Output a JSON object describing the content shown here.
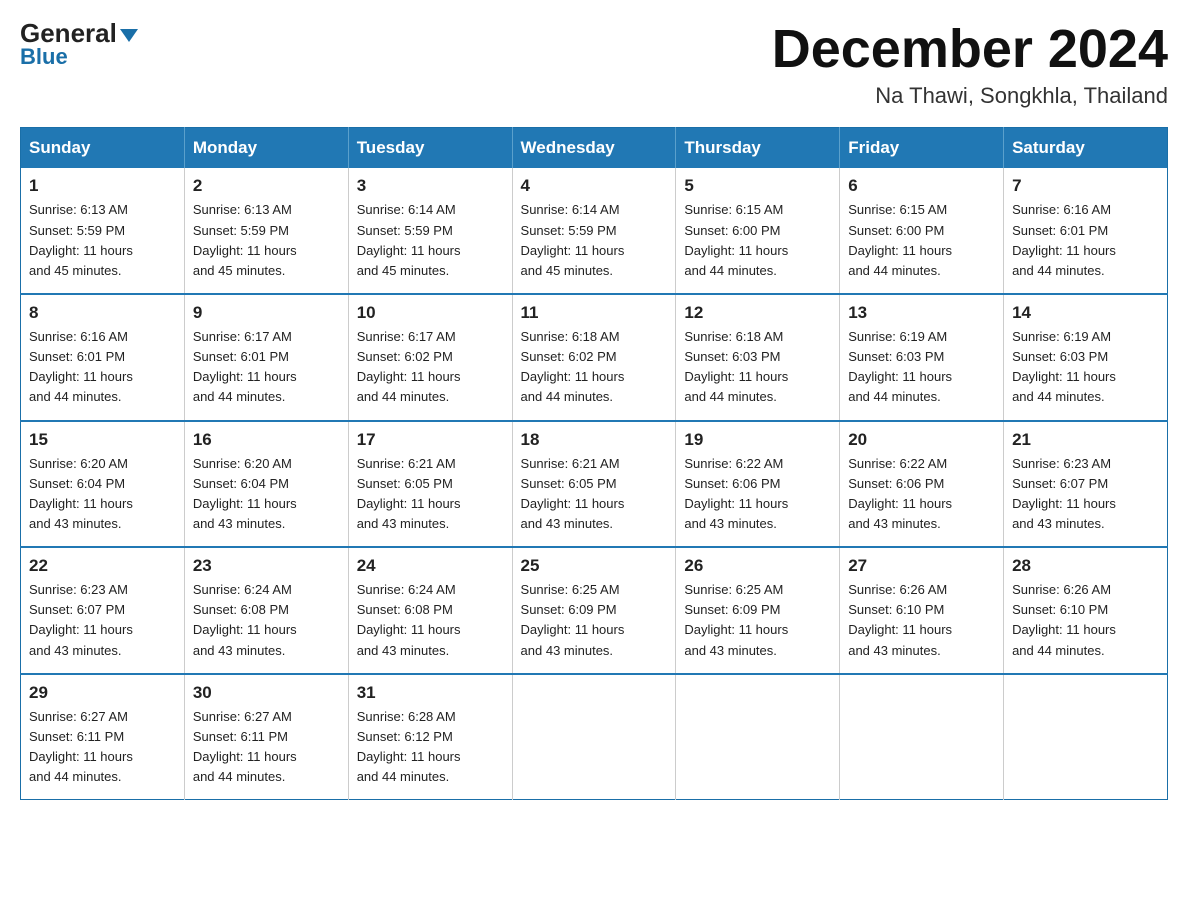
{
  "header": {
    "logo_general": "General",
    "logo_blue": "Blue",
    "month_title": "December 2024",
    "subtitle": "Na Thawi, Songkhla, Thailand"
  },
  "weekdays": [
    "Sunday",
    "Monday",
    "Tuesday",
    "Wednesday",
    "Thursday",
    "Friday",
    "Saturday"
  ],
  "weeks": [
    [
      {
        "day": "1",
        "sunrise": "6:13 AM",
        "sunset": "5:59 PM",
        "daylight": "11 hours and 45 minutes."
      },
      {
        "day": "2",
        "sunrise": "6:13 AM",
        "sunset": "5:59 PM",
        "daylight": "11 hours and 45 minutes."
      },
      {
        "day": "3",
        "sunrise": "6:14 AM",
        "sunset": "5:59 PM",
        "daylight": "11 hours and 45 minutes."
      },
      {
        "day": "4",
        "sunrise": "6:14 AM",
        "sunset": "5:59 PM",
        "daylight": "11 hours and 45 minutes."
      },
      {
        "day": "5",
        "sunrise": "6:15 AM",
        "sunset": "6:00 PM",
        "daylight": "11 hours and 44 minutes."
      },
      {
        "day": "6",
        "sunrise": "6:15 AM",
        "sunset": "6:00 PM",
        "daylight": "11 hours and 44 minutes."
      },
      {
        "day": "7",
        "sunrise": "6:16 AM",
        "sunset": "6:01 PM",
        "daylight": "11 hours and 44 minutes."
      }
    ],
    [
      {
        "day": "8",
        "sunrise": "6:16 AM",
        "sunset": "6:01 PM",
        "daylight": "11 hours and 44 minutes."
      },
      {
        "day": "9",
        "sunrise": "6:17 AM",
        "sunset": "6:01 PM",
        "daylight": "11 hours and 44 minutes."
      },
      {
        "day": "10",
        "sunrise": "6:17 AM",
        "sunset": "6:02 PM",
        "daylight": "11 hours and 44 minutes."
      },
      {
        "day": "11",
        "sunrise": "6:18 AM",
        "sunset": "6:02 PM",
        "daylight": "11 hours and 44 minutes."
      },
      {
        "day": "12",
        "sunrise": "6:18 AM",
        "sunset": "6:03 PM",
        "daylight": "11 hours and 44 minutes."
      },
      {
        "day": "13",
        "sunrise": "6:19 AM",
        "sunset": "6:03 PM",
        "daylight": "11 hours and 44 minutes."
      },
      {
        "day": "14",
        "sunrise": "6:19 AM",
        "sunset": "6:03 PM",
        "daylight": "11 hours and 44 minutes."
      }
    ],
    [
      {
        "day": "15",
        "sunrise": "6:20 AM",
        "sunset": "6:04 PM",
        "daylight": "11 hours and 43 minutes."
      },
      {
        "day": "16",
        "sunrise": "6:20 AM",
        "sunset": "6:04 PM",
        "daylight": "11 hours and 43 minutes."
      },
      {
        "day": "17",
        "sunrise": "6:21 AM",
        "sunset": "6:05 PM",
        "daylight": "11 hours and 43 minutes."
      },
      {
        "day": "18",
        "sunrise": "6:21 AM",
        "sunset": "6:05 PM",
        "daylight": "11 hours and 43 minutes."
      },
      {
        "day": "19",
        "sunrise": "6:22 AM",
        "sunset": "6:06 PM",
        "daylight": "11 hours and 43 minutes."
      },
      {
        "day": "20",
        "sunrise": "6:22 AM",
        "sunset": "6:06 PM",
        "daylight": "11 hours and 43 minutes."
      },
      {
        "day": "21",
        "sunrise": "6:23 AM",
        "sunset": "6:07 PM",
        "daylight": "11 hours and 43 minutes."
      }
    ],
    [
      {
        "day": "22",
        "sunrise": "6:23 AM",
        "sunset": "6:07 PM",
        "daylight": "11 hours and 43 minutes."
      },
      {
        "day": "23",
        "sunrise": "6:24 AM",
        "sunset": "6:08 PM",
        "daylight": "11 hours and 43 minutes."
      },
      {
        "day": "24",
        "sunrise": "6:24 AM",
        "sunset": "6:08 PM",
        "daylight": "11 hours and 43 minutes."
      },
      {
        "day": "25",
        "sunrise": "6:25 AM",
        "sunset": "6:09 PM",
        "daylight": "11 hours and 43 minutes."
      },
      {
        "day": "26",
        "sunrise": "6:25 AM",
        "sunset": "6:09 PM",
        "daylight": "11 hours and 43 minutes."
      },
      {
        "day": "27",
        "sunrise": "6:26 AM",
        "sunset": "6:10 PM",
        "daylight": "11 hours and 43 minutes."
      },
      {
        "day": "28",
        "sunrise": "6:26 AM",
        "sunset": "6:10 PM",
        "daylight": "11 hours and 44 minutes."
      }
    ],
    [
      {
        "day": "29",
        "sunrise": "6:27 AM",
        "sunset": "6:11 PM",
        "daylight": "11 hours and 44 minutes."
      },
      {
        "day": "30",
        "sunrise": "6:27 AM",
        "sunset": "6:11 PM",
        "daylight": "11 hours and 44 minutes."
      },
      {
        "day": "31",
        "sunrise": "6:28 AM",
        "sunset": "6:12 PM",
        "daylight": "11 hours and 44 minutes."
      },
      null,
      null,
      null,
      null
    ]
  ],
  "labels": {
    "sunrise": "Sunrise:",
    "sunset": "Sunset:",
    "daylight": "Daylight:"
  }
}
